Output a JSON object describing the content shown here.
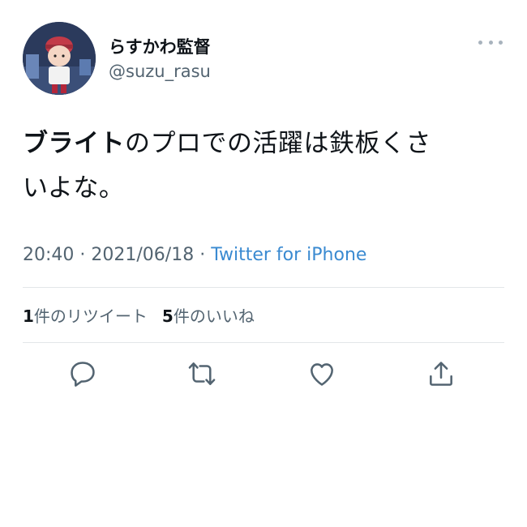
{
  "tweet": {
    "author": {
      "name": "らすかわ監督",
      "handle": "@suzu_rasu"
    },
    "text": {
      "mention": "ブライト",
      "rest_line1": "のプロでの活躍は鉄板くさ",
      "line2": "いよな。"
    },
    "meta": {
      "time": "20:40",
      "separator1": " · ",
      "date": "2021/06/18",
      "separator2": " · ",
      "source": "Twitter for iPhone"
    },
    "stats": {
      "retweets_count": "1",
      "retweets_label": "件のリツイート",
      "likes_count": "5",
      "likes_label": "件のいいね"
    },
    "icons": {
      "more": "more-horizontal-icon",
      "reply": "reply-icon",
      "retweet": "retweet-icon",
      "like": "heart-icon",
      "share": "share-icon"
    },
    "colors": {
      "text": "#0f1419",
      "secondary": "#536471",
      "link": "#3a8ad1",
      "divider": "#e3e6e9"
    }
  }
}
